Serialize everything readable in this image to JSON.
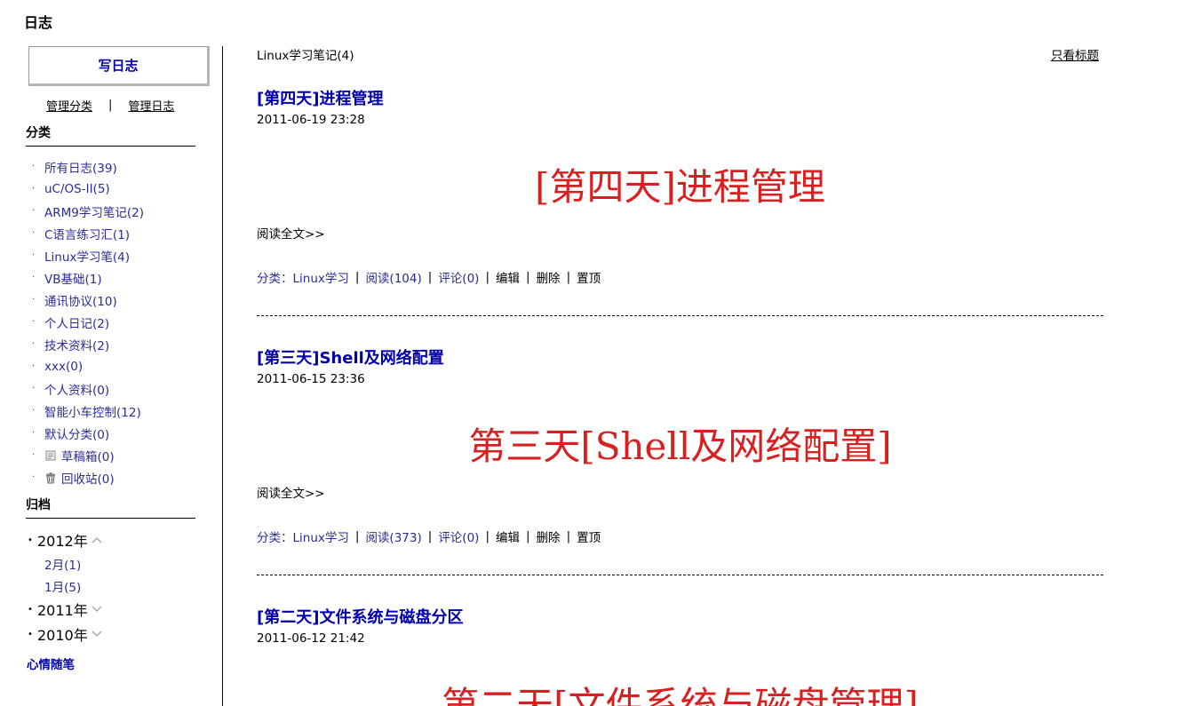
{
  "page_title": "日志",
  "sidebar": {
    "write_button": "写日志",
    "manage_category": "管理分类",
    "manage_separator": "|",
    "manage_blog": "管理日志",
    "categories_title": "分类",
    "categories": [
      {
        "label": "所有日志(39)",
        "icon": ""
      },
      {
        "label": "uC/OS-II(5)",
        "icon": ""
      },
      {
        "label": "ARM9学习笔记(2)",
        "icon": ""
      },
      {
        "label": "C语言练习汇(1)",
        "icon": ""
      },
      {
        "label": "Linux学习笔(4)",
        "icon": ""
      },
      {
        "label": "VB基础(1)",
        "icon": ""
      },
      {
        "label": "通讯协议(10)",
        "icon": ""
      },
      {
        "label": "个人日记(2)",
        "icon": ""
      },
      {
        "label": "技术资料(2)",
        "icon": ""
      },
      {
        "label": "xxx(0)",
        "icon": ""
      },
      {
        "label": "个人资料(0)",
        "icon": ""
      },
      {
        "label": "智能小车控制(12)",
        "icon": ""
      },
      {
        "label": "默认分类(0)",
        "icon": ""
      },
      {
        "label": "草稿箱(0)",
        "icon": "draft-icon"
      },
      {
        "label": "回收站(0)",
        "icon": "trash-icon"
      }
    ],
    "archive_title": "归档",
    "archive": [
      {
        "year": "2012年",
        "expanded": true,
        "months": [
          "2月(1)",
          "1月(5)"
        ]
      },
      {
        "year": "2011年",
        "expanded": false,
        "months": []
      },
      {
        "year": "2010年",
        "expanded": false,
        "months": []
      }
    ],
    "mood_link": "心情随笔"
  },
  "main": {
    "crumb": "Linux学习笔记(4)",
    "title_only": "只看标题",
    "posts": [
      {
        "title": "[第四天]进程管理",
        "date": "2011-06-19 23:28",
        "banner": "[第四天]进程管理",
        "read_more": "阅读全文>>",
        "category_label": "分类：",
        "category": "Linux学习",
        "reads": "阅读(104)",
        "comments": "评论(0)",
        "edit": "编辑",
        "delete": "删除",
        "pin": "置顶"
      },
      {
        "title": "[第三天]Shell及网络配置",
        "date": "2011-06-15 23:36",
        "banner": "第三天[Shell及网络配置]",
        "read_more": "阅读全文>>",
        "category_label": "分类：",
        "category": "Linux学习",
        "reads": "阅读(373)",
        "comments": "评论(0)",
        "edit": "编辑",
        "delete": "删除",
        "pin": "置顶"
      },
      {
        "title": "[第二天]文件系统与磁盘分区",
        "date": "2011-06-12 21:42",
        "banner": "第二天[文件系统与磁盘管理]"
      }
    ]
  }
}
